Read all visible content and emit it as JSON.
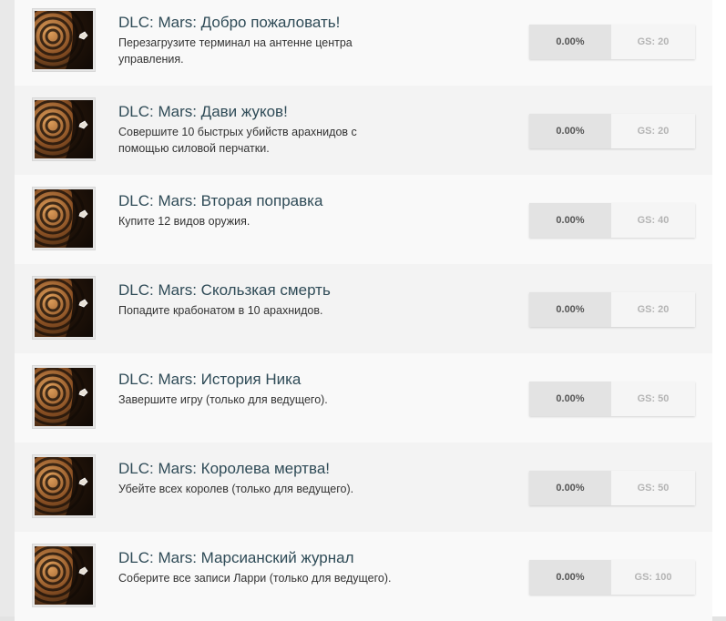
{
  "achievements": [
    {
      "title": "DLC: Mars: Добро пожаловать!",
      "description": "Перезагрузите терминал на антенне центра управления.",
      "percent": "0.00%",
      "gs": "GS: 20"
    },
    {
      "title": "DLC: Mars: Дави жуков!",
      "description": "Совершите 10 быстрых убийств арахнидов с помощью силовой перчатки.",
      "percent": "0.00%",
      "gs": "GS: 20"
    },
    {
      "title": "DLC: Mars: Вторая поправка",
      "description": "Купите 12 видов оружия.",
      "percent": "0.00%",
      "gs": "GS: 40"
    },
    {
      "title": "DLC: Mars: Скользкая смерть",
      "description": "Попадите крабонатом в 10 арахнидов.",
      "percent": "0.00%",
      "gs": "GS: 20"
    },
    {
      "title": "DLC: Mars: История Ника",
      "description": "Завершите игру (только для ведущего).",
      "percent": "0.00%",
      "gs": "GS: 50"
    },
    {
      "title": "DLC: Mars: Королева мертва!",
      "description": "Убейте всех королев (только для ведущего).",
      "percent": "0.00%",
      "gs": "GS: 50"
    },
    {
      "title": "DLC: Mars: Марсианский журнал",
      "description": "Соберите все записи Ларри (только для ведущего).",
      "percent": "0.00%",
      "gs": "GS: 100"
    }
  ]
}
